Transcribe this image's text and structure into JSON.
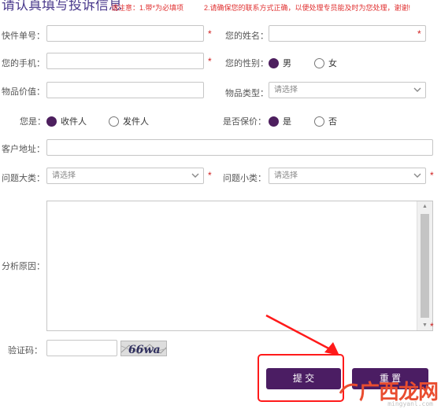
{
  "header": {
    "title": "请认真填写投诉信息",
    "notice_1": "请注意：1.带*为必填项",
    "notice_2": "2.请确保您的联系方式正确，以便处理专员能及时为您处理，谢谢!"
  },
  "form": {
    "required_mark": "*",
    "express_no": {
      "label": "快件单号：",
      "value": ""
    },
    "name": {
      "label": "您的姓名：",
      "value": ""
    },
    "phone": {
      "label": "您的手机：",
      "value": ""
    },
    "gender": {
      "label": "您的性别：",
      "options": [
        "男",
        "女"
      ],
      "selected": "男"
    },
    "item_value": {
      "label": "物品价值：",
      "value": ""
    },
    "item_type": {
      "label": "物品类型：",
      "placeholder": "请选择"
    },
    "role": {
      "label": "您是：",
      "options": [
        "收件人",
        "发件人"
      ],
      "selected": "收件人"
    },
    "insured": {
      "label": "是否保价：",
      "options": [
        "是",
        "否"
      ],
      "selected": "是"
    },
    "address": {
      "label": "客户地址：",
      "value": ""
    },
    "issue_major": {
      "label": "问题大类：",
      "placeholder": "请选择"
    },
    "issue_minor": {
      "label": "问题小类：",
      "placeholder": "请选择"
    },
    "reason": {
      "label": "分析原因：",
      "value": ""
    },
    "captcha": {
      "label": "验证码：",
      "value": "",
      "image_text": "66wa"
    }
  },
  "buttons": {
    "submit": "提 交",
    "reset": "重 置"
  },
  "annotation": {
    "arrow_color": "#ff1a1a"
  },
  "watermark": {
    "text": "广西龙网",
    "url": "mingyanl.com"
  },
  "colors": {
    "accent": "#4b1d63",
    "required": "#d02020",
    "notice": "#e03030",
    "title": "#4a3a8c"
  }
}
